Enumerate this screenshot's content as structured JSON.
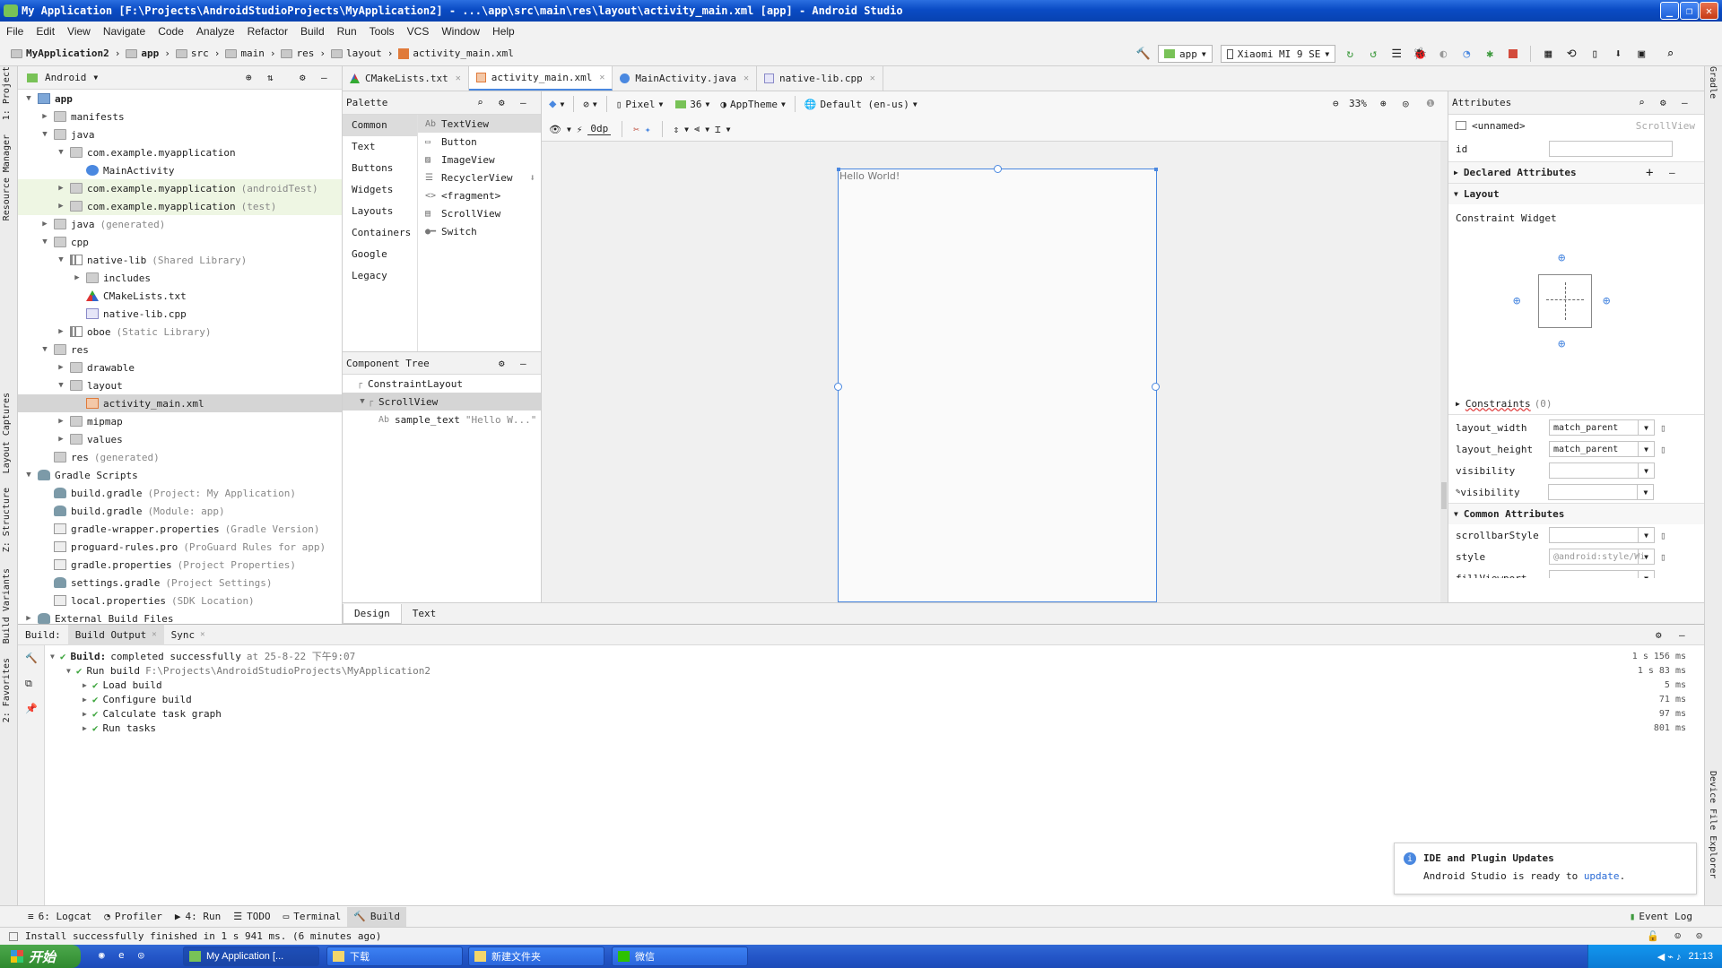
{
  "window": {
    "title": "My Application [F:\\Projects\\AndroidStudioProjects\\MyApplication2] - ...\\app\\src\\main\\res\\layout\\activity_main.xml [app] - Android Studio"
  },
  "menu": [
    "File",
    "Edit",
    "View",
    "Navigate",
    "Code",
    "Analyze",
    "Refactor",
    "Build",
    "Run",
    "Tools",
    "VCS",
    "Window",
    "Help"
  ],
  "breadcrumbs": [
    "MyApplication2",
    "app",
    "src",
    "main",
    "res",
    "layout",
    "activity_main.xml"
  ],
  "toolbar": {
    "run_config": "app",
    "device": "Xiaomi MI 9 SE"
  },
  "project": {
    "view": "Android",
    "tree": [
      {
        "label": "app",
        "note": "",
        "level": 0,
        "arrow": "▼",
        "icon": "folder-b"
      },
      {
        "label": "manifests",
        "note": "",
        "level": 1,
        "arrow": "▶",
        "icon": "folder"
      },
      {
        "label": "java",
        "note": "",
        "level": 1,
        "arrow": "▼",
        "icon": "folder"
      },
      {
        "label": "com.example.myapplication",
        "note": "",
        "level": 2,
        "arrow": "▼",
        "icon": "folder"
      },
      {
        "label": "MainActivity",
        "note": "",
        "level": 3,
        "arrow": "",
        "icon": "class"
      },
      {
        "label": "com.example.myapplication",
        "note": "(androidTest)",
        "level": 2,
        "arrow": "▶",
        "icon": "folder",
        "hl": true
      },
      {
        "label": "com.example.myapplication",
        "note": "(test)",
        "level": 2,
        "arrow": "▶",
        "icon": "folder",
        "hl": true
      },
      {
        "label": "java",
        "note": "(generated)",
        "level": 1,
        "arrow": "▶",
        "icon": "folder"
      },
      {
        "label": "cpp",
        "note": "",
        "level": 1,
        "arrow": "▼",
        "icon": "folder"
      },
      {
        "label": "native-lib",
        "note": "(Shared Library)",
        "level": 2,
        "arrow": "▼",
        "icon": "lib"
      },
      {
        "label": "includes",
        "note": "",
        "level": 3,
        "arrow": "▶",
        "icon": "folder"
      },
      {
        "label": "CMakeLists.txt",
        "note": "",
        "level": 3,
        "arrow": "",
        "icon": "cmake"
      },
      {
        "label": "native-lib.cpp",
        "note": "",
        "level": 3,
        "arrow": "",
        "icon": "cpp"
      },
      {
        "label": "oboe",
        "note": "(Static Library)",
        "level": 2,
        "arrow": "▶",
        "icon": "lib"
      },
      {
        "label": "res",
        "note": "",
        "level": 1,
        "arrow": "▼",
        "icon": "folder"
      },
      {
        "label": "drawable",
        "note": "",
        "level": 2,
        "arrow": "▶",
        "icon": "folder"
      },
      {
        "label": "layout",
        "note": "",
        "level": 2,
        "arrow": "▼",
        "icon": "folder"
      },
      {
        "label": "activity_main.xml",
        "note": "",
        "level": 3,
        "arrow": "",
        "icon": "xml",
        "sel": true
      },
      {
        "label": "mipmap",
        "note": "",
        "level": 2,
        "arrow": "▶",
        "icon": "folder"
      },
      {
        "label": "values",
        "note": "",
        "level": 2,
        "arrow": "▶",
        "icon": "folder"
      },
      {
        "label": "res",
        "note": "(generated)",
        "level": 1,
        "arrow": "",
        "icon": "folder"
      },
      {
        "label": "Gradle Scripts",
        "note": "",
        "level": 0,
        "arrow": "▼",
        "icon": "gradle"
      },
      {
        "label": "build.gradle",
        "note": "(Project: My Application)",
        "level": 1,
        "arrow": "",
        "icon": "gradle"
      },
      {
        "label": "build.gradle",
        "note": "(Module: app)",
        "level": 1,
        "arrow": "",
        "icon": "gradle"
      },
      {
        "label": "gradle-wrapper.properties",
        "note": "(Gradle Version)",
        "level": 1,
        "arrow": "",
        "icon": "file"
      },
      {
        "label": "proguard-rules.pro",
        "note": "(ProGuard Rules for app)",
        "level": 1,
        "arrow": "",
        "icon": "file"
      },
      {
        "label": "gradle.properties",
        "note": "(Project Properties)",
        "level": 1,
        "arrow": "",
        "icon": "file"
      },
      {
        "label": "settings.gradle",
        "note": "(Project Settings)",
        "level": 1,
        "arrow": "",
        "icon": "gradle"
      },
      {
        "label": "local.properties",
        "note": "(SDK Location)",
        "level": 1,
        "arrow": "",
        "icon": "file"
      },
      {
        "label": "External Build Files",
        "note": "",
        "level": 0,
        "arrow": "▶",
        "icon": "gradle"
      }
    ]
  },
  "editor_tabs": [
    {
      "label": "CMakeLists.txt",
      "icon": "cmake"
    },
    {
      "label": "activity_main.xml",
      "icon": "xml",
      "active": true
    },
    {
      "label": "MainActivity.java",
      "icon": "class"
    },
    {
      "label": "native-lib.cpp",
      "icon": "cpp"
    }
  ],
  "palette": {
    "title": "Palette",
    "categories": [
      "Common",
      "Text",
      "Buttons",
      "Widgets",
      "Layouts",
      "Containers",
      "Google",
      "Legacy"
    ],
    "items": [
      {
        "glyph": "Ab",
        "label": "TextView"
      },
      {
        "glyph": "▭",
        "label": "Button"
      },
      {
        "glyph": "▨",
        "label": "ImageView"
      },
      {
        "glyph": "☰",
        "label": "RecyclerView"
      },
      {
        "glyph": "<>",
        "label": "<fragment>"
      },
      {
        "glyph": "▤",
        "label": "ScrollView"
      },
      {
        "glyph": "●━",
        "label": "Switch"
      }
    ]
  },
  "component_tree": {
    "title": "Component Tree",
    "nodes": [
      {
        "label": "ConstraintLayout",
        "note": ""
      },
      {
        "label": "ScrollView",
        "note": ""
      },
      {
        "label": "sample_text",
        "note": "\"Hello W...\""
      }
    ]
  },
  "design_toolbar": {
    "device": "Pixel",
    "api": "36",
    "theme": "AppTheme",
    "locale": "Default (en-us)",
    "zoom": "33%",
    "margin": "0dp"
  },
  "canvas": {
    "hello_text": "Hello World!"
  },
  "attributes": {
    "title": "Attributes",
    "widget_id": "<unnamed>",
    "widget_type": "ScrollView",
    "id_label": "id",
    "declared": "Declared Attributes",
    "layout": "Layout",
    "constraint_widget": "Constraint Widget",
    "constraints": "Constraints",
    "constraints_count": "(0)",
    "rows": [
      {
        "label": "layout_width",
        "value": "match_parent"
      },
      {
        "label": "layout_height",
        "value": "match_parent"
      },
      {
        "label": "visibility",
        "value": ""
      },
      {
        "label": "visibility",
        "value": ""
      }
    ],
    "common": "Common Attributes",
    "common_rows": [
      {
        "label": "scrollbarStyle",
        "value": ""
      },
      {
        "label": "style",
        "value": "@android:style/Wi"
      },
      {
        "label": "fillViewport",
        "value": ""
      }
    ]
  },
  "design_tabs": [
    "Design",
    "Text"
  ],
  "build": {
    "tabs": [
      {
        "label": "Build:",
        "closable": false
      },
      {
        "label": "Build Output",
        "closable": true,
        "active": true
      },
      {
        "label": "Sync",
        "closable": true
      }
    ],
    "lines": [
      {
        "bold": "Build:",
        "text": "completed successfully",
        "meta": "at 25-8-22 下午9:07",
        "duration": "1 s 156 ms",
        "level": 0
      },
      {
        "bold": "",
        "text": "Run build",
        "meta": "F:\\Projects\\AndroidStudioProjects\\MyApplication2",
        "duration": "1 s 83 ms",
        "level": 1
      },
      {
        "bold": "",
        "text": "Load build",
        "meta": "",
        "duration": "5 ms",
        "level": 2
      },
      {
        "bold": "",
        "text": "Configure build",
        "meta": "",
        "duration": "71 ms",
        "level": 2
      },
      {
        "bold": "",
        "text": "Calculate task graph",
        "meta": "",
        "duration": "97 ms",
        "level": 2
      },
      {
        "bold": "",
        "text": "Run tasks",
        "meta": "",
        "duration": "801 ms",
        "level": 2
      }
    ]
  },
  "notification": {
    "title": "IDE and Plugin Updates",
    "body": "Android Studio is ready to",
    "link": "update",
    "tail": "."
  },
  "tool_windows": [
    {
      "label": "6: Logcat"
    },
    {
      "label": "Profiler"
    },
    {
      "label": "4: Run"
    },
    {
      "label": "TODO"
    },
    {
      "label": "Terminal"
    },
    {
      "label": "Build",
      "active": true
    }
  ],
  "event_log": "Event Log",
  "status": {
    "text": "Install successfully finished in 1 s 941 ms. (6 minutes ago)"
  },
  "side_tabs_left": [
    "1: Project",
    "Resource Manager",
    "Layout Captures",
    "Z: Structure",
    "Build Variants",
    "2: Favorites"
  ],
  "side_tabs_right": [
    "Gradle",
    "Device File Explorer"
  ],
  "taskbar": {
    "start": "开始",
    "buttons": [
      "My Application [...",
      "下载",
      "新建文件夹",
      "微信"
    ],
    "clock": "21:13"
  },
  "colors": {
    "accent": "#4a88e0",
    "success": "#3ea53e",
    "title_bar": "#0a4bc4"
  }
}
